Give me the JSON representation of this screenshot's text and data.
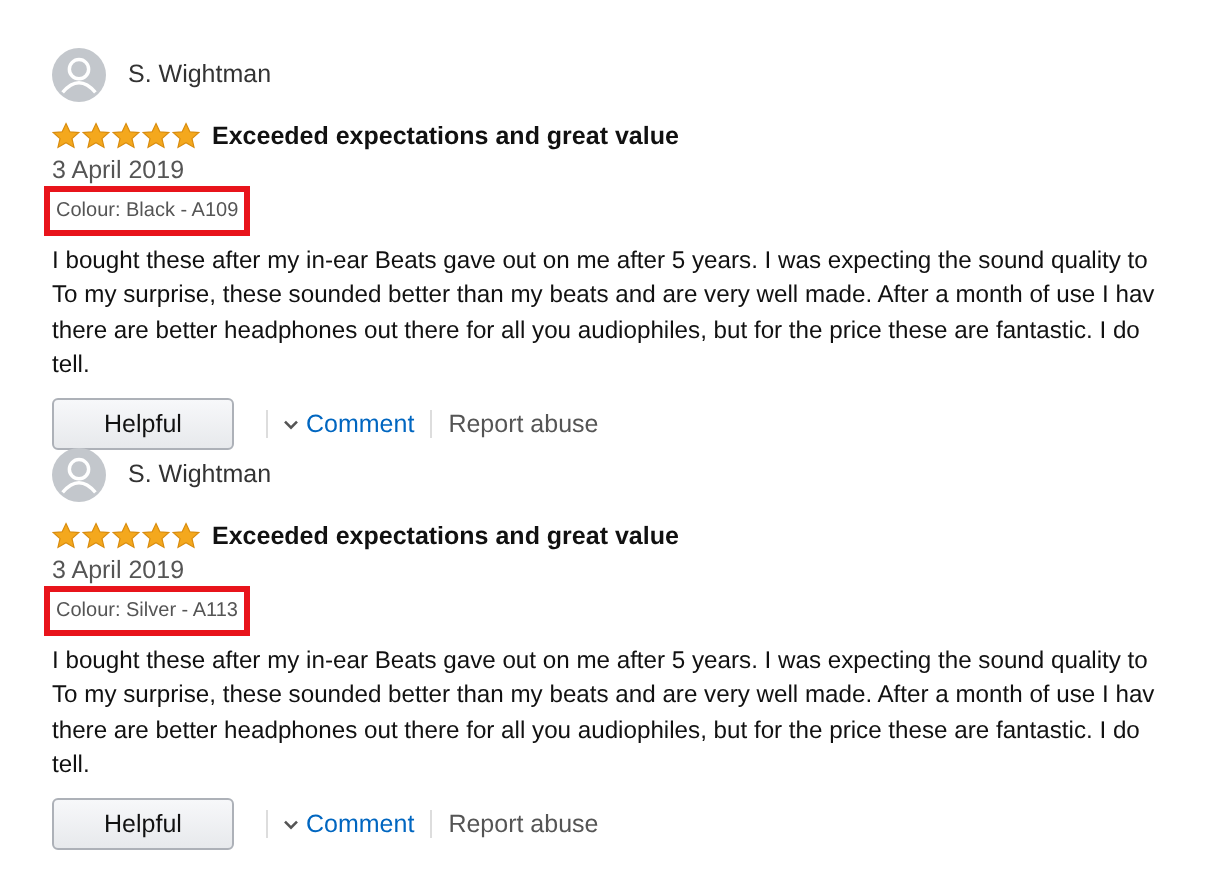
{
  "reviews": [
    {
      "reviewer": "S. Wightman",
      "stars": 5,
      "title": "Exceeded expectations and great value",
      "date": "3 April 2019",
      "variant": "Colour: Black - A109",
      "variant_highlighted": true,
      "body_lines": [
        "I bought these after my in-ear Beats gave out on me after 5 years. I was expecting the sound quality to",
        "To my surprise, these sounded better than my beats and are very well made. After a month of use I hav",
        "there are better headphones out there for all you audiophiles, but for the price these are fantastic. I do",
        "tell."
      ],
      "helpful_button": "Helpful",
      "comment_link": "Comment",
      "report_link": "Report abuse"
    },
    {
      "reviewer": "S. Wightman",
      "stars": 5,
      "title": "Exceeded expectations and great value",
      "date": "3 April 2019",
      "variant": "Colour: Silver - A113",
      "variant_highlighted": true,
      "body_lines": [
        "I bought these after my in-ear Beats gave out on me after 5 years. I was expecting the sound quality to",
        "To my surprise, these sounded better than my beats and are very well made. After a month of use I hav",
        "there are better headphones out there for all you audiophiles, but for the price these are fantastic. I do",
        "tell."
      ],
      "helpful_button": "Helpful",
      "comment_link": "Comment",
      "report_link": "Report abuse"
    }
  ]
}
